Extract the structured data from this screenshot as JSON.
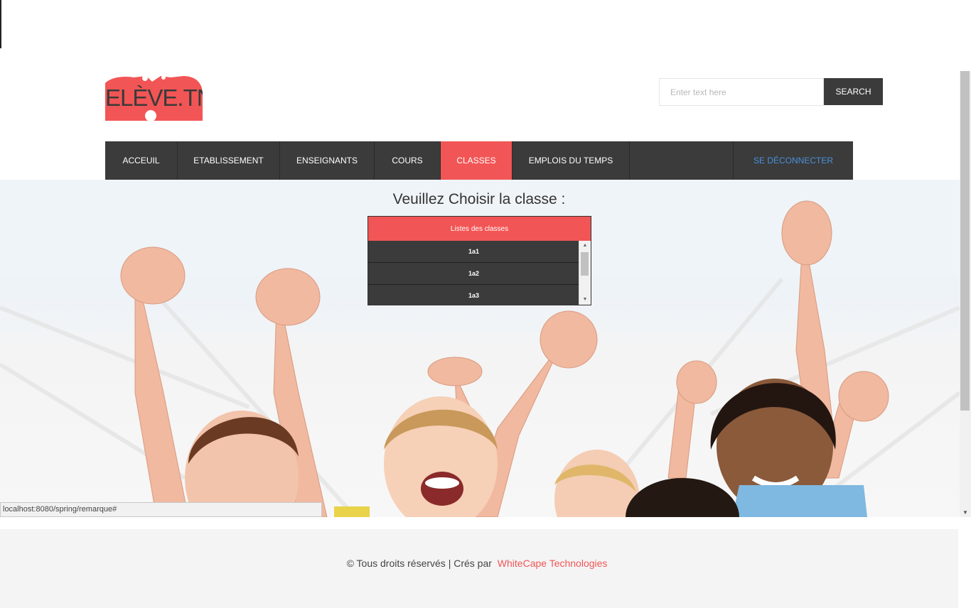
{
  "header": {
    "logo_text": "ELÈVE.TN",
    "search_placeholder": "Enter text here",
    "search_button": "SEARCH"
  },
  "nav": {
    "items": [
      {
        "label": "ACCEUIL",
        "active": false
      },
      {
        "label": "ETABLISSEMENT",
        "active": false
      },
      {
        "label": "ENSEIGNANTS",
        "active": false
      },
      {
        "label": "COURS",
        "active": false
      },
      {
        "label": "CLASSES",
        "active": true
      },
      {
        "label": "EMPLOIS DU TEMPS",
        "active": false
      }
    ],
    "logout": "SE DÉCONNECTER"
  },
  "main": {
    "heading": "Veuillez Choisir la classe :",
    "class_list_title": "Listes des classes",
    "classes": [
      "1a1",
      "1a2",
      "1a3"
    ]
  },
  "status_bar": {
    "url": "localhost:8080/spring/remarque#"
  },
  "footer": {
    "text": "© Tous droits réservés | Crés par",
    "link": "WhiteCape Technologies"
  },
  "colors": {
    "accent": "#f25555",
    "nav_bg": "#3b3b3b",
    "logout": "#4a90d9"
  }
}
